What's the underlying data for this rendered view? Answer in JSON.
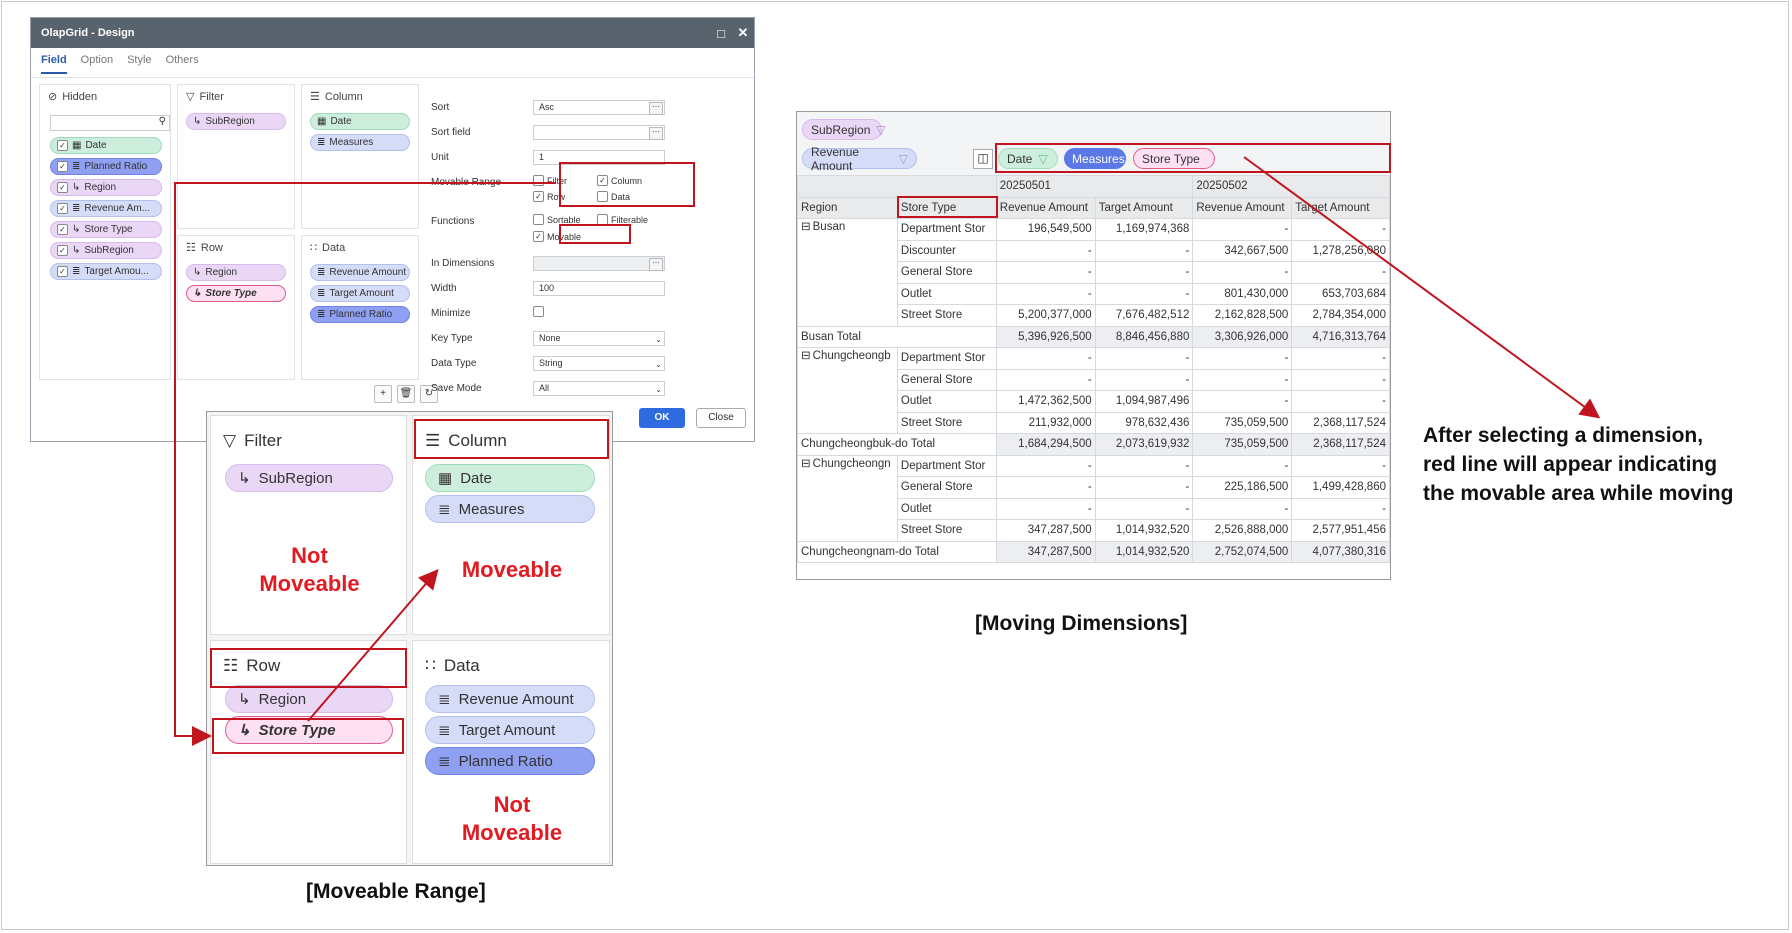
{
  "dialog": {
    "title": "OlapGrid - Design",
    "tabs": [
      "Field",
      "Option",
      "Style",
      "Others"
    ],
    "hidden": {
      "label": "Hidden",
      "items": [
        "Date",
        "Planned Ratio",
        "Region",
        "Revenue Am...",
        "Store Type",
        "SubRegion",
        "Target Amou..."
      ]
    },
    "filter": {
      "label": "Filter",
      "items": [
        "SubRegion"
      ]
    },
    "column": {
      "label": "Column",
      "items": [
        "Date",
        "Measures"
      ]
    },
    "row": {
      "label": "Row",
      "items": [
        "Region",
        "Store Type"
      ]
    },
    "data": {
      "label": "Data",
      "items": [
        "Revenue Amount",
        "Target Amount",
        "Planned Ratio"
      ]
    },
    "properties": {
      "sort": {
        "label": "Sort",
        "value": "Asc"
      },
      "sort_field": {
        "label": "Sort field",
        "value": ""
      },
      "unit": {
        "label": "Unit",
        "value": "1"
      },
      "movable_range": {
        "label": "Movable Range",
        "options": [
          "Filter",
          "Column",
          "Row",
          "Data"
        ],
        "checked": [
          "Column",
          "Row"
        ]
      },
      "functions": {
        "label": "Functions",
        "options": [
          "Sortable",
          "Filterable",
          "Movable"
        ],
        "checked": [
          "Movable"
        ]
      },
      "in_dimensions": {
        "label": "In Dimensions",
        "value": ""
      },
      "width": {
        "label": "Width",
        "value": "100"
      },
      "minimize": {
        "label": "Minimize"
      },
      "key_type": {
        "label": "Key Type",
        "value": "None"
      },
      "data_type": {
        "label": "Data Type",
        "value": "String"
      },
      "save_mode": {
        "label": "Save Mode",
        "value": "All"
      }
    },
    "buttons": {
      "ok": "OK",
      "close": "Close"
    }
  },
  "zoom": {
    "filter": {
      "label": "Filter",
      "items": [
        "SubRegion"
      ]
    },
    "column": {
      "label": "Column",
      "items": [
        "Date",
        "Measures"
      ]
    },
    "row": {
      "label": "Row",
      "items": [
        "Region",
        "Store Type"
      ]
    },
    "data": {
      "label": "Data",
      "items": [
        "Revenue Amount",
        "Target Amount",
        "Planned Ratio"
      ]
    },
    "annotations": {
      "not_moveable_filter": [
        "Not",
        "Moveable"
      ],
      "moveable": "Moveable",
      "not_moveable_data": [
        "Not",
        "Moveable"
      ]
    },
    "caption": "[Moveable Range]"
  },
  "grid": {
    "filter_field": "SubRegion",
    "data_field": "Revenue Amount",
    "column_fields": [
      "Date",
      "Measures",
      "Store Type"
    ],
    "date_headers": [
      "20250501",
      "20250502"
    ],
    "row_headers": [
      "Region",
      "Store Type"
    ],
    "measure_headers": [
      "Revenue Amount",
      "Target Amount",
      "Revenue Amount",
      "Target Amount"
    ],
    "groups": [
      {
        "name": "Busan",
        "rows": [
          [
            "Department Stor",
            "196,549,500",
            "1,169,974,368",
            "-",
            "-"
          ],
          [
            "Discounter",
            "-",
            "-",
            "342,667,500",
            "1,278,256,080"
          ],
          [
            "General Store",
            "-",
            "-",
            "-",
            "-"
          ],
          [
            "Outlet",
            "-",
            "-",
            "801,430,000",
            "653,703,684"
          ],
          [
            "Street Store",
            "5,200,377,000",
            "7,676,482,512",
            "2,162,828,500",
            "2,784,354,000"
          ]
        ],
        "total": [
          "Busan Total",
          "5,396,926,500",
          "8,846,456,880",
          "3,306,926,000",
          "4,716,313,764"
        ]
      },
      {
        "name": "Chungcheongb",
        "rows": [
          [
            "Department Stor",
            "-",
            "-",
            "-",
            "-"
          ],
          [
            "General Store",
            "-",
            "-",
            "-",
            "-"
          ],
          [
            "Outlet",
            "1,472,362,500",
            "1,094,987,496",
            "-",
            "-"
          ],
          [
            "Street Store",
            "211,932,000",
            "978,632,436",
            "735,059,500",
            "2,368,117,524"
          ]
        ],
        "total": [
          "Chungcheongbuk-do Total",
          "1,684,294,500",
          "2,073,619,932",
          "735,059,500",
          "2,368,117,524"
        ]
      },
      {
        "name": "Chungcheongn",
        "rows": [
          [
            "Department Stor",
            "-",
            "-",
            "-",
            "-"
          ],
          [
            "General Store",
            "-",
            "-",
            "225,186,500",
            "1,499,428,860"
          ],
          [
            "Outlet",
            "-",
            "-",
            "-",
            "-"
          ],
          [
            "Street Store",
            "347,287,500",
            "1,014,932,520",
            "2,526,888,000",
            "2,577,951,456"
          ]
        ],
        "total": [
          "Chungcheongnam-do Total",
          "347,287,500",
          "1,014,932,520",
          "2,752,074,500",
          "4,077,380,316"
        ]
      }
    ],
    "caption": "[Moving Dimensions]",
    "note": [
      "After selecting a dimension,",
      "red line will appear indicating",
      "the movable area while moving"
    ]
  },
  "colors": {
    "annotation_red": "#c0151f",
    "ok_blue": "#2f6be0"
  }
}
